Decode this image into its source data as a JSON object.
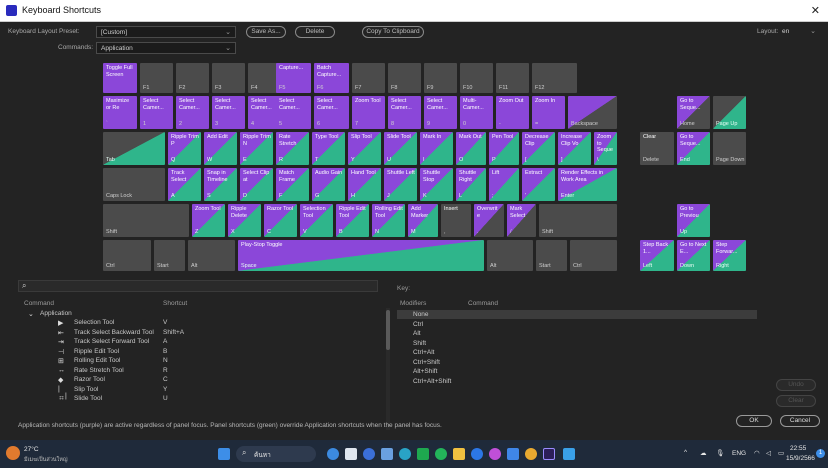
{
  "window": {
    "title": "Keyboard Shortcuts",
    "close": "✕"
  },
  "top": {
    "preset_label": "Keyboard Layout Preset:",
    "preset_value": "[Custom]",
    "commands_label": "Commands:",
    "commands_value": "Application",
    "save_as": "Save As...",
    "delete": "Delete",
    "copy": "Copy To Clipboard",
    "layout_label": "Layout:",
    "layout_value": "en"
  },
  "keys": {
    "esc": {
      "cmd": "Toggle Full Screen",
      "cap": ""
    },
    "f1": {
      "cap": "F1"
    },
    "f2": {
      "cap": "F2"
    },
    "f3": {
      "cap": "F3"
    },
    "f4": {
      "cap": "F4"
    },
    "f5": {
      "cmd": "Capture...",
      "cap": "F5"
    },
    "f6": {
      "cmd": "Batch Capture...",
      "cap": "F6"
    },
    "f7": {
      "cap": "F7"
    },
    "f8": {
      "cap": "F8"
    },
    "f9": {
      "cap": "F9"
    },
    "f10": {
      "cap": "F10"
    },
    "f11": {
      "cap": "F11"
    },
    "f12": {
      "cap": "F12"
    },
    "grave": {
      "cmd": "Maximize or Re",
      "cap": "`"
    },
    "n1": {
      "cmd": "Select Camer...",
      "cap": "1"
    },
    "n2": {
      "cmd": "Select Camer...",
      "cap": "2"
    },
    "n3": {
      "cmd": "Select Camer...",
      "cap": "3"
    },
    "n4": {
      "cmd": "Select Camer...",
      "cap": "4"
    },
    "n5": {
      "cmd": "Select Camer...",
      "cap": "5"
    },
    "n6": {
      "cmd": "Select Camer...",
      "cap": "6"
    },
    "n7": {
      "cmd": "Zoom Tool",
      "cap": "7"
    },
    "n8": {
      "cmd": "Select Camer...",
      "cap": "8"
    },
    "n9": {
      "cmd": "Select Camer...",
      "cap": "9"
    },
    "n0": {
      "cmd": "Multi-Camer...",
      "cap": "0"
    },
    "minus": {
      "cmd": "Zoom Out",
      "cap": "-"
    },
    "equal": {
      "cmd": "Zoom In",
      "cap": "="
    },
    "backspace": {
      "cmd": "",
      "cap": "Backspace"
    },
    "ins": {
      "cmd": "Go to Seque...",
      "cap": "Home"
    },
    "pgup": {
      "cmd": "",
      "cap": "Page Up"
    },
    "tab": {
      "cap": "Tab"
    },
    "q": {
      "cmd": "Ripple Trim P",
      "cap": "Q"
    },
    "w": {
      "cmd": "Add Edit",
      "cap": "W"
    },
    "e": {
      "cmd": "Ripple Trim N",
      "cap": "E"
    },
    "r": {
      "cmd": "Rate Stretch",
      "cap": "R"
    },
    "t": {
      "cmd": "Type Tool",
      "cap": "T"
    },
    "y": {
      "cmd": "Slip Tool",
      "cap": "Y"
    },
    "u": {
      "cmd": "Slide Tool",
      "cap": "U"
    },
    "i": {
      "cmd": "Mark In",
      "cap": "I"
    },
    "o": {
      "cmd": "Mark Out",
      "cap": "O"
    },
    "p": {
      "cmd": "Pen Tool",
      "cap": "P"
    },
    "lbr": {
      "cmd": "Decrease Clip",
      "cap": "["
    },
    "rbr": {
      "cmd": "Increase Clip Vo",
      "cap": "]"
    },
    "bslash": {
      "cmd": "Zoom to Seque",
      "cap": "\\"
    },
    "del": {
      "cmd": "Clear",
      "cap": "Delete"
    },
    "end": {
      "cmd": "Go to Seque...",
      "cap": "End"
    },
    "pgdn": {
      "cmd": "",
      "cap": "Page Down"
    },
    "caps": {
      "cap": "Caps Lock"
    },
    "a": {
      "cmd": "Track Select",
      "cap": "A"
    },
    "s": {
      "cmd": "Snap in Timeline",
      "cap": "S"
    },
    "d": {
      "cmd": "Select Clip at",
      "cap": "D"
    },
    "f": {
      "cmd": "Match Frame",
      "cap": "F"
    },
    "g": {
      "cmd": "Audio Gain",
      "cap": "G"
    },
    "h": {
      "cmd": "Hand Tool",
      "cap": "H"
    },
    "j": {
      "cmd": "Shuttle Left",
      "cap": "J"
    },
    "k": {
      "cmd": "Shuttle Stop",
      "cap": "K"
    },
    "l": {
      "cmd": "Shuttle Right",
      "cap": "L"
    },
    "semi": {
      "cmd": "Lift",
      "cap": ";"
    },
    "quote": {
      "cmd": "Extract",
      "cap": "'"
    },
    "enter": {
      "cmd": "Render Effects in Work Area",
      "cap": "Enter"
    },
    "lshift": {
      "cap": "Shift"
    },
    "z": {
      "cmd": "Zoom Tool",
      "cap": "Z"
    },
    "x": {
      "cmd": "Ripple Delete",
      "cap": "X"
    },
    "c": {
      "cmd": "Razor Tool",
      "cap": "C"
    },
    "v": {
      "cmd": "Selection Tool",
      "cap": "V"
    },
    "b": {
      "cmd": "Ripple Edit Tool",
      "cap": "B"
    },
    "n": {
      "cmd": "Rolling Edit Tool",
      "cap": "N"
    },
    "m": {
      "cmd": "Add Marker",
      "cap": "M"
    },
    "comma": {
      "cmd": "Insert",
      "cap": ","
    },
    "period": {
      "cmd": "Overwrit e",
      "cap": "."
    },
    "slash": {
      "cmd": "Mark Select",
      "cap": "/"
    },
    "rshift": {
      "cap": "Shift"
    },
    "up": {
      "cmd": "Go to Previou",
      "cap": "Up"
    },
    "lctrl": {
      "cap": "Ctrl"
    },
    "lstart": {
      "cap": "Start"
    },
    "lalt": {
      "cap": "Alt"
    },
    "space": {
      "cmd": "Play-Stop Toggle",
      "cap": "Space"
    },
    "ralt": {
      "cap": "Alt"
    },
    "rstart": {
      "cap": "Start"
    },
    "rctrl": {
      "cap": "Ctrl"
    },
    "left": {
      "cmd": "Step Back 1...",
      "cap": "Left"
    },
    "down": {
      "cmd": "Go to Next E...",
      "cap": "Down"
    },
    "right": {
      "cmd": "Step Forwar...",
      "cap": "Right"
    }
  },
  "list": {
    "search_placeholder": "",
    "col_command": "Command",
    "col_shortcut": "Shortcut",
    "group": "Application",
    "rows": [
      {
        "icon": "selection-tool-icon",
        "glyph": "▶",
        "name": "Selection Tool",
        "shortcut": "V"
      },
      {
        "icon": "track-select-backward-icon",
        "glyph": "⇤",
        "name": "Track Select Backward Tool",
        "shortcut": "Shift+A"
      },
      {
        "icon": "track-select-forward-icon",
        "glyph": "⇥",
        "name": "Track Select Forward Tool",
        "shortcut": "A"
      },
      {
        "icon": "ripple-edit-icon",
        "glyph": "⊣",
        "name": "Ripple Edit Tool",
        "shortcut": "B"
      },
      {
        "icon": "rolling-edit-icon",
        "glyph": "⊞",
        "name": "Rolling Edit Tool",
        "shortcut": "N"
      },
      {
        "icon": "rate-stretch-icon",
        "glyph": "↔",
        "name": "Rate Stretch Tool",
        "shortcut": "R"
      },
      {
        "icon": "razor-tool-icon",
        "glyph": "◆",
        "name": "Razor Tool",
        "shortcut": "C"
      },
      {
        "icon": "slip-tool-icon",
        "glyph": "|↔|",
        "name": "Slip Tool",
        "shortcut": "Y"
      },
      {
        "icon": "slide-tool-icon",
        "glyph": "↔",
        "name": "Slide Tool",
        "shortcut": "U"
      }
    ]
  },
  "keypanel": {
    "title": "Key:",
    "col_modifiers": "Modifiers",
    "col_command": "Command",
    "rows": [
      "None",
      "Ctrl",
      "Alt",
      "Shift",
      "Ctrl+Alt",
      "Ctrl+Shift",
      "Alt+Shift",
      "Ctrl+Alt+Shift"
    ]
  },
  "buttons": {
    "undo": "Undo",
    "clear": "Clear",
    "ok": "OK",
    "cancel": "Cancel"
  },
  "footnote": "Application shortcuts (purple) are active regardless of panel focus. Panel shortcuts (green) override Application shortcuts when the panel has focus.",
  "taskbar": {
    "weather_temp": "27°C",
    "weather_text": "มีเมฆเป็นส่วนใหญ่",
    "search": "ค้นหา",
    "lang": "ENG",
    "time": "22:55",
    "date": "15/9/2566",
    "badge": "1",
    "colors": {
      "bg": "#1f2a3a",
      "app": "#8b47d9",
      "panel": "#2fb58b"
    }
  }
}
